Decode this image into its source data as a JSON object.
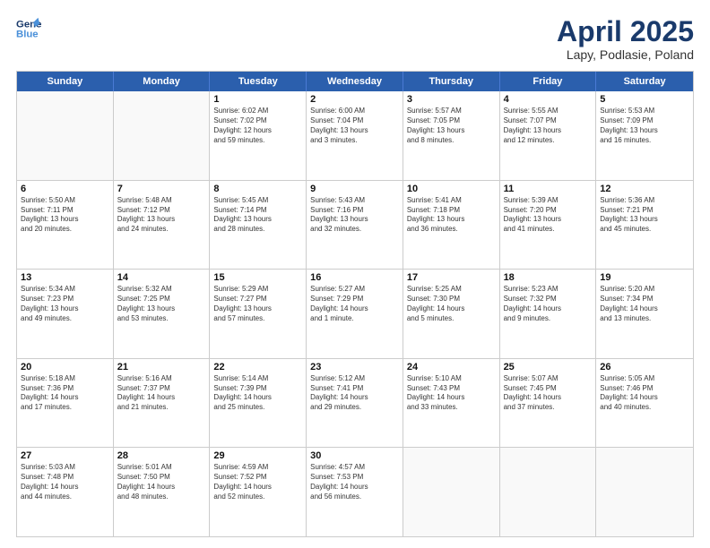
{
  "header": {
    "logo_line1": "General",
    "logo_line2": "Blue",
    "title": "April 2025",
    "subtitle": "Lapy, Podlasie, Poland"
  },
  "days_of_week": [
    "Sunday",
    "Monday",
    "Tuesday",
    "Wednesday",
    "Thursday",
    "Friday",
    "Saturday"
  ],
  "rows": [
    [
      {
        "day": "",
        "info": ""
      },
      {
        "day": "",
        "info": ""
      },
      {
        "day": "1",
        "info": "Sunrise: 6:02 AM\nSunset: 7:02 PM\nDaylight: 12 hours\nand 59 minutes."
      },
      {
        "day": "2",
        "info": "Sunrise: 6:00 AM\nSunset: 7:04 PM\nDaylight: 13 hours\nand 3 minutes."
      },
      {
        "day": "3",
        "info": "Sunrise: 5:57 AM\nSunset: 7:05 PM\nDaylight: 13 hours\nand 8 minutes."
      },
      {
        "day": "4",
        "info": "Sunrise: 5:55 AM\nSunset: 7:07 PM\nDaylight: 13 hours\nand 12 minutes."
      },
      {
        "day": "5",
        "info": "Sunrise: 5:53 AM\nSunset: 7:09 PM\nDaylight: 13 hours\nand 16 minutes."
      }
    ],
    [
      {
        "day": "6",
        "info": "Sunrise: 5:50 AM\nSunset: 7:11 PM\nDaylight: 13 hours\nand 20 minutes."
      },
      {
        "day": "7",
        "info": "Sunrise: 5:48 AM\nSunset: 7:12 PM\nDaylight: 13 hours\nand 24 minutes."
      },
      {
        "day": "8",
        "info": "Sunrise: 5:45 AM\nSunset: 7:14 PM\nDaylight: 13 hours\nand 28 minutes."
      },
      {
        "day": "9",
        "info": "Sunrise: 5:43 AM\nSunset: 7:16 PM\nDaylight: 13 hours\nand 32 minutes."
      },
      {
        "day": "10",
        "info": "Sunrise: 5:41 AM\nSunset: 7:18 PM\nDaylight: 13 hours\nand 36 minutes."
      },
      {
        "day": "11",
        "info": "Sunrise: 5:39 AM\nSunset: 7:20 PM\nDaylight: 13 hours\nand 41 minutes."
      },
      {
        "day": "12",
        "info": "Sunrise: 5:36 AM\nSunset: 7:21 PM\nDaylight: 13 hours\nand 45 minutes."
      }
    ],
    [
      {
        "day": "13",
        "info": "Sunrise: 5:34 AM\nSunset: 7:23 PM\nDaylight: 13 hours\nand 49 minutes."
      },
      {
        "day": "14",
        "info": "Sunrise: 5:32 AM\nSunset: 7:25 PM\nDaylight: 13 hours\nand 53 minutes."
      },
      {
        "day": "15",
        "info": "Sunrise: 5:29 AM\nSunset: 7:27 PM\nDaylight: 13 hours\nand 57 minutes."
      },
      {
        "day": "16",
        "info": "Sunrise: 5:27 AM\nSunset: 7:29 PM\nDaylight: 14 hours\nand 1 minute."
      },
      {
        "day": "17",
        "info": "Sunrise: 5:25 AM\nSunset: 7:30 PM\nDaylight: 14 hours\nand 5 minutes."
      },
      {
        "day": "18",
        "info": "Sunrise: 5:23 AM\nSunset: 7:32 PM\nDaylight: 14 hours\nand 9 minutes."
      },
      {
        "day": "19",
        "info": "Sunrise: 5:20 AM\nSunset: 7:34 PM\nDaylight: 14 hours\nand 13 minutes."
      }
    ],
    [
      {
        "day": "20",
        "info": "Sunrise: 5:18 AM\nSunset: 7:36 PM\nDaylight: 14 hours\nand 17 minutes."
      },
      {
        "day": "21",
        "info": "Sunrise: 5:16 AM\nSunset: 7:37 PM\nDaylight: 14 hours\nand 21 minutes."
      },
      {
        "day": "22",
        "info": "Sunrise: 5:14 AM\nSunset: 7:39 PM\nDaylight: 14 hours\nand 25 minutes."
      },
      {
        "day": "23",
        "info": "Sunrise: 5:12 AM\nSunset: 7:41 PM\nDaylight: 14 hours\nand 29 minutes."
      },
      {
        "day": "24",
        "info": "Sunrise: 5:10 AM\nSunset: 7:43 PM\nDaylight: 14 hours\nand 33 minutes."
      },
      {
        "day": "25",
        "info": "Sunrise: 5:07 AM\nSunset: 7:45 PM\nDaylight: 14 hours\nand 37 minutes."
      },
      {
        "day": "26",
        "info": "Sunrise: 5:05 AM\nSunset: 7:46 PM\nDaylight: 14 hours\nand 40 minutes."
      }
    ],
    [
      {
        "day": "27",
        "info": "Sunrise: 5:03 AM\nSunset: 7:48 PM\nDaylight: 14 hours\nand 44 minutes."
      },
      {
        "day": "28",
        "info": "Sunrise: 5:01 AM\nSunset: 7:50 PM\nDaylight: 14 hours\nand 48 minutes."
      },
      {
        "day": "29",
        "info": "Sunrise: 4:59 AM\nSunset: 7:52 PM\nDaylight: 14 hours\nand 52 minutes."
      },
      {
        "day": "30",
        "info": "Sunrise: 4:57 AM\nSunset: 7:53 PM\nDaylight: 14 hours\nand 56 minutes."
      },
      {
        "day": "",
        "info": ""
      },
      {
        "day": "",
        "info": ""
      },
      {
        "day": "",
        "info": ""
      }
    ]
  ]
}
